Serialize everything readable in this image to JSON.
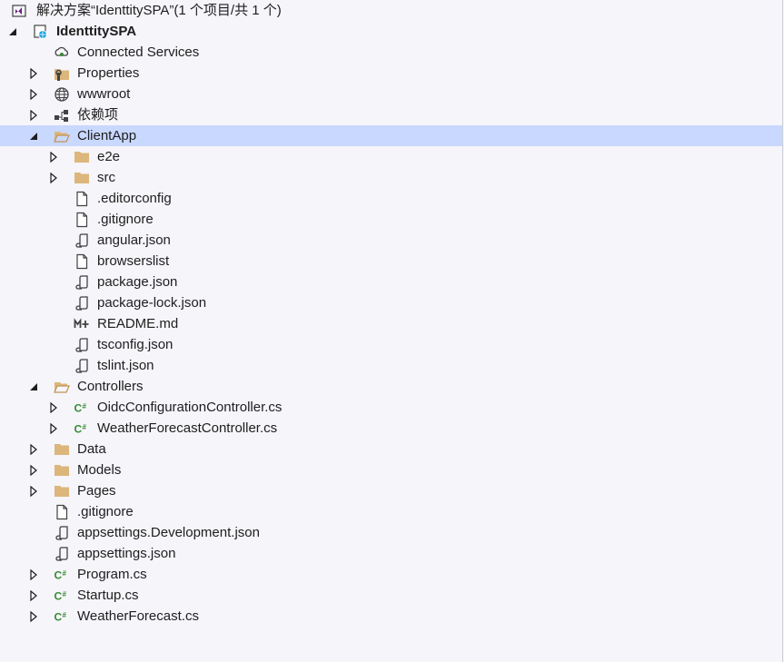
{
  "solution_title": "解决方案“IdenttitySPA”(1 个项目/共 1 个)",
  "project_name": "IdenttitySPA",
  "nodes": [
    {
      "label": "Connected Services",
      "icon": "connected-services-icon"
    },
    {
      "label": "Properties",
      "icon": "properties-icon"
    },
    {
      "label": "wwwroot",
      "icon": "globe-icon"
    },
    {
      "label": "依赖项",
      "icon": "dependencies-icon"
    },
    {
      "label": "ClientApp",
      "icon": "folder-open-icon"
    },
    {
      "label": "e2e",
      "icon": "folder-icon"
    },
    {
      "label": "src",
      "icon": "folder-icon"
    },
    {
      "label": ".editorconfig",
      "icon": "file-icon"
    },
    {
      "label": ".gitignore",
      "icon": "file-icon"
    },
    {
      "label": "angular.json",
      "icon": "json-icon"
    },
    {
      "label": "browserslist",
      "icon": "file-icon"
    },
    {
      "label": "package.json",
      "icon": "json-icon"
    },
    {
      "label": "package-lock.json",
      "icon": "json-icon"
    },
    {
      "label": "README.md",
      "icon": "markdown-icon"
    },
    {
      "label": "tsconfig.json",
      "icon": "json-icon"
    },
    {
      "label": "tslint.json",
      "icon": "json-icon"
    },
    {
      "label": "Controllers",
      "icon": "folder-open-icon"
    },
    {
      "label": "OidcConfigurationController.cs",
      "icon": "csharp-icon"
    },
    {
      "label": "WeatherForecastController.cs",
      "icon": "csharp-icon"
    },
    {
      "label": "Data",
      "icon": "folder-icon"
    },
    {
      "label": "Models",
      "icon": "folder-icon"
    },
    {
      "label": "Pages",
      "icon": "folder-icon"
    },
    {
      "label": ".gitignore",
      "icon": "file-icon"
    },
    {
      "label": "appsettings.Development.json",
      "icon": "json-icon"
    },
    {
      "label": "appsettings.json",
      "icon": "json-icon"
    },
    {
      "label": "Program.cs",
      "icon": "csharp-icon"
    },
    {
      "label": "Startup.cs",
      "icon": "csharp-icon"
    },
    {
      "label": "WeatherForecast.cs",
      "icon": "csharp-icon"
    }
  ],
  "colors": {
    "selection": "#c9d8ff",
    "folder": "#dcb67a",
    "csharp": "#388a34",
    "icon_dark": "#424242"
  }
}
